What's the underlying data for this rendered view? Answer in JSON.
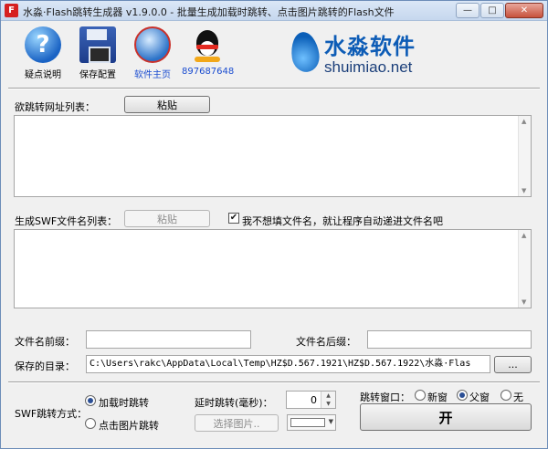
{
  "window": {
    "app_icon": "F",
    "title": "水淼·Flash跳转生成器 v1.9.0.0 - 批量生成加载时跳转、点击图片跳转的Flash文件",
    "minimize": "—",
    "maximize": "□",
    "close": "✕"
  },
  "toolbar": {
    "help_label": "疑点说明",
    "help_glyph": "?",
    "save_label": "保存配置",
    "home_label": "软件主页",
    "qq_label": "897687648"
  },
  "logo": {
    "cn": "水淼软件",
    "en": "shuimiao.net"
  },
  "urls": {
    "label": "欲跳转网址列表：",
    "paste_button": "粘贴"
  },
  "swf_names": {
    "label": "生成SWF文件名列表：",
    "paste_button": "粘贴",
    "auto_name_checked": true,
    "auto_name_label": "我不想填文件名，就让程序自动递进文件名吧"
  },
  "prefix": {
    "label": "文件名前缀：",
    "value": ""
  },
  "suffix": {
    "label": "文件名后缀：",
    "value": ""
  },
  "save_dir": {
    "label": "保存的目录：",
    "value": "C:\\Users\\rakc\\AppData\\Local\\Temp\\HZ$D.567.1921\\HZ$D.567.1922\\水淼·Flas",
    "browse_button": "..."
  },
  "jump_mode": {
    "label": "SWF跳转方式：",
    "option_load": "加载时跳转",
    "option_click": "点击图片跳转",
    "selected": "load"
  },
  "delay": {
    "label": "延时跳转(毫秒)：",
    "value": "0"
  },
  "choose_image": {
    "button": "选择图片.."
  },
  "target_window": {
    "label": "跳转窗口：",
    "option_new": "新窗",
    "option_parent": "父窗",
    "option_none": "无",
    "selected": "parent"
  },
  "start": {
    "label": "开"
  },
  "colors": {
    "accent": "#1a4cd0",
    "logo_blue": "#0d5cb6",
    "close_red": "#c7513c"
  },
  "icons": [
    "help-icon",
    "save-icon",
    "globe-icon",
    "qq-penguin-icon",
    "logo-drop-icon",
    "checkbox-check-icon"
  ]
}
